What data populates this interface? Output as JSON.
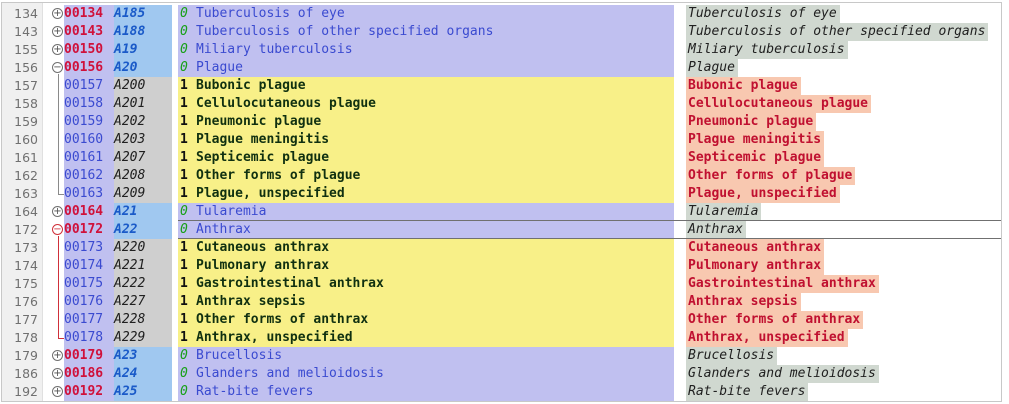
{
  "rows": [
    {
      "line": "134",
      "fold": "plus",
      "code": "00134",
      "icd": "A185",
      "level": "0",
      "name": "Tuberculosis of eye",
      "desc": "Tuberculosis of eye",
      "kind": "parent"
    },
    {
      "line": "143",
      "fold": "plus",
      "code": "00143",
      "icd": "A188",
      "level": "0",
      "name": "Tuberculosis of other specified organs",
      "desc": "Tuberculosis of other specified organs",
      "kind": "parent"
    },
    {
      "line": "155",
      "fold": "plus",
      "code": "00150",
      "icd": "A19",
      "level": "0",
      "name": "Miliary tuberculosis",
      "desc": "Miliary tuberculosis",
      "kind": "parent"
    },
    {
      "line": "156",
      "fold": "minus",
      "code": "00156",
      "icd": "A20",
      "level": "0",
      "name": "Plague",
      "desc": "Plague",
      "kind": "parent"
    },
    {
      "line": "157",
      "fold": "",
      "code": "00157",
      "icd": "A200",
      "level": "1",
      "name": "Bubonic plague",
      "desc": "Bubonic plague",
      "kind": "child"
    },
    {
      "line": "158",
      "fold": "",
      "code": "00158",
      "icd": "A201",
      "level": "1",
      "name": "Cellulocutaneous plague",
      "desc": "Cellulocutaneous plague",
      "kind": "child"
    },
    {
      "line": "159",
      "fold": "",
      "code": "00159",
      "icd": "A202",
      "level": "1",
      "name": "Pneumonic plague",
      "desc": "Pneumonic plague",
      "kind": "child"
    },
    {
      "line": "160",
      "fold": "",
      "code": "00160",
      "icd": "A203",
      "level": "1",
      "name": "Plague meningitis",
      "desc": "Plague meningitis",
      "kind": "child"
    },
    {
      "line": "161",
      "fold": "",
      "code": "00161",
      "icd": "A207",
      "level": "1",
      "name": "Septicemic plague",
      "desc": "Septicemic plague",
      "kind": "child"
    },
    {
      "line": "162",
      "fold": "",
      "code": "00162",
      "icd": "A208",
      "level": "1",
      "name": "Other forms of plague",
      "desc": "Other forms of plague",
      "kind": "child"
    },
    {
      "line": "163",
      "fold": "",
      "code": "00163",
      "icd": "A209",
      "level": "1",
      "name": "Plague, unspecified",
      "desc": "Plague, unspecified",
      "kind": "child"
    },
    {
      "line": "164",
      "fold": "plus",
      "code": "00164",
      "icd": "A21",
      "level": "0",
      "name": "Tularemia",
      "desc": "Tularemia",
      "kind": "parent"
    },
    {
      "line": "172",
      "fold": "minus-red",
      "code": "00172",
      "icd": "A22",
      "level": "0",
      "name": "Anthrax",
      "desc": "Anthrax",
      "kind": "parent"
    },
    {
      "line": "173",
      "fold": "",
      "code": "00173",
      "icd": "A220",
      "level": "1",
      "name": "Cutaneous anthrax",
      "desc": "Cutaneous anthrax",
      "kind": "child"
    },
    {
      "line": "174",
      "fold": "",
      "code": "00174",
      "icd": "A221",
      "level": "1",
      "name": "Pulmonary anthrax",
      "desc": "Pulmonary anthrax",
      "kind": "child"
    },
    {
      "line": "175",
      "fold": "",
      "code": "00175",
      "icd": "A222",
      "level": "1",
      "name": "Gastrointestinal anthrax",
      "desc": "Gastrointestinal anthrax",
      "kind": "child"
    },
    {
      "line": "176",
      "fold": "",
      "code": "00176",
      "icd": "A227",
      "level": "1",
      "name": "Anthrax sepsis",
      "desc": "Anthrax sepsis",
      "kind": "child"
    },
    {
      "line": "177",
      "fold": "",
      "code": "00177",
      "icd": "A228",
      "level": "1",
      "name": "Other forms of anthrax",
      "desc": "Other forms of anthrax",
      "kind": "child"
    },
    {
      "line": "178",
      "fold": "",
      "code": "00178",
      "icd": "A229",
      "level": "1",
      "name": "Anthrax, unspecified",
      "desc": "Anthrax, unspecified",
      "kind": "child"
    },
    {
      "line": "179",
      "fold": "plus",
      "code": "00179",
      "icd": "A23",
      "level": "0",
      "name": "Brucellosis",
      "desc": "Brucellosis",
      "kind": "parent"
    },
    {
      "line": "186",
      "fold": "plus",
      "code": "00186",
      "icd": "A24",
      "level": "0",
      "name": "Glanders and melioidosis",
      "desc": "Glanders and melioidosis",
      "kind": "parent"
    },
    {
      "line": "192",
      "fold": "plus",
      "code": "00192",
      "icd": "A25",
      "level": "0",
      "name": "Rat-bite fevers",
      "desc": "Rat-bite fevers",
      "kind": "parent"
    }
  ],
  "icons": {
    "fold_collapsed": "plus-circle-icon",
    "fold_expanded": "minus-circle-icon"
  },
  "colors": {
    "parent_bg": "#c0c0f0",
    "child_bg": "#f8f088",
    "code_red": "#d0103a",
    "icd_blue": "#1a5ac8",
    "desc_parent_bg": "#d0d8d0",
    "desc_child_bg": "#f8c8b0",
    "fold_red": "#d0303a"
  }
}
